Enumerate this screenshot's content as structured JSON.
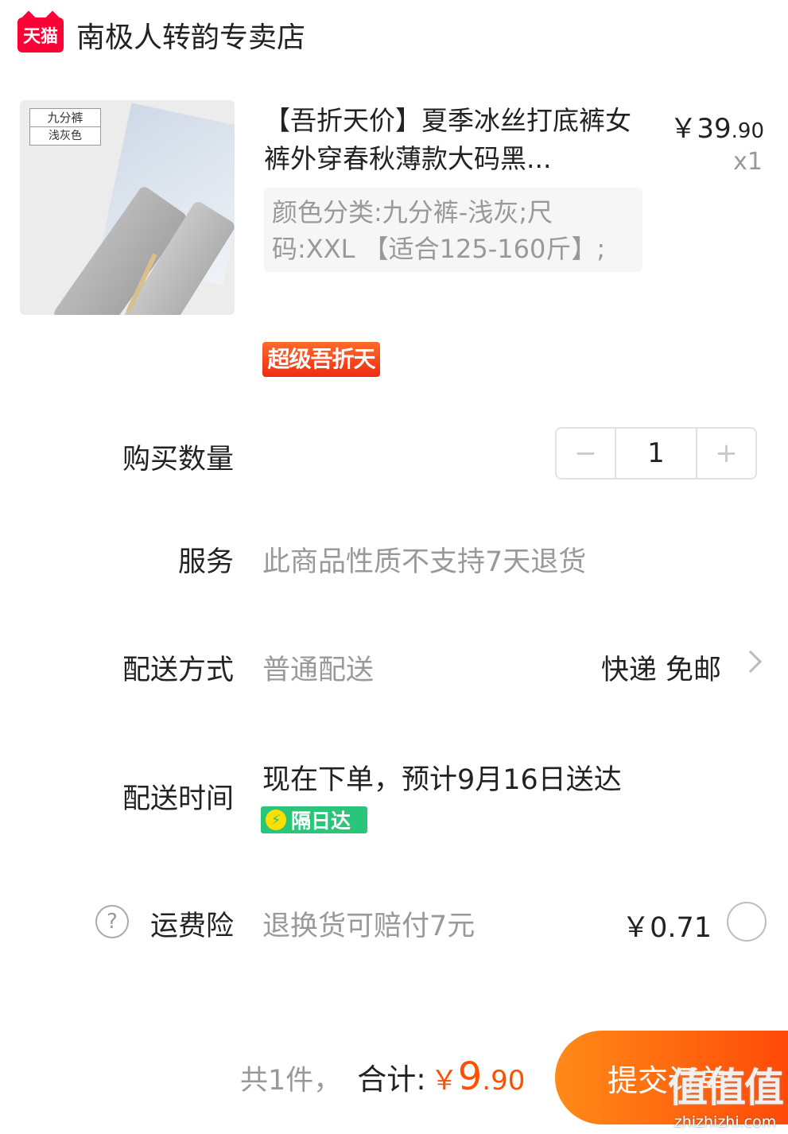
{
  "store": {
    "logo_text": "天猫",
    "name": "南极人转韵专卖店"
  },
  "product": {
    "image_tag_line1": "九分裤",
    "image_tag_line2": "浅灰色",
    "title": "【吾折天价】夏季冰丝打底裤女裤外穿春秋薄款大码黑...",
    "price_symbol": "￥",
    "price_int": "39",
    "price_dec": ".90",
    "quantity_label": "x1",
    "sku": "颜色分类:九分裤-浅灰;尺码:XXL 【适合125-160斤】;",
    "promo_badge": "超级吾折天"
  },
  "quantity": {
    "label": "购买数量",
    "minus": "−",
    "value": "1",
    "plus": "+"
  },
  "service": {
    "label": "服务",
    "value": "此商品性质不支持7天退货"
  },
  "delivery": {
    "label": "配送方式",
    "value": "普通配送",
    "right": "快递 免邮"
  },
  "delivery_time": {
    "label": "配送时间",
    "value": "现在下单，预计9月16日送达",
    "badge_icon": "⚡",
    "badge": "隔日达"
  },
  "insurance": {
    "help_icon": "?",
    "label": "运费险",
    "value": "退换货可赔付7元",
    "price": "￥0.71"
  },
  "footer": {
    "count": "共1件，",
    "total_label": "合计:",
    "total_symbol": "￥",
    "total_int": "9",
    "total_dec": ".90",
    "submit": "提交订单"
  },
  "watermark": {
    "logo": "值值值",
    "url": "zhizhizhi.com"
  },
  "colors": {
    "accent": "#ff5000",
    "tmall_red": "#ff0036",
    "green_badge": "#2bc57a"
  }
}
